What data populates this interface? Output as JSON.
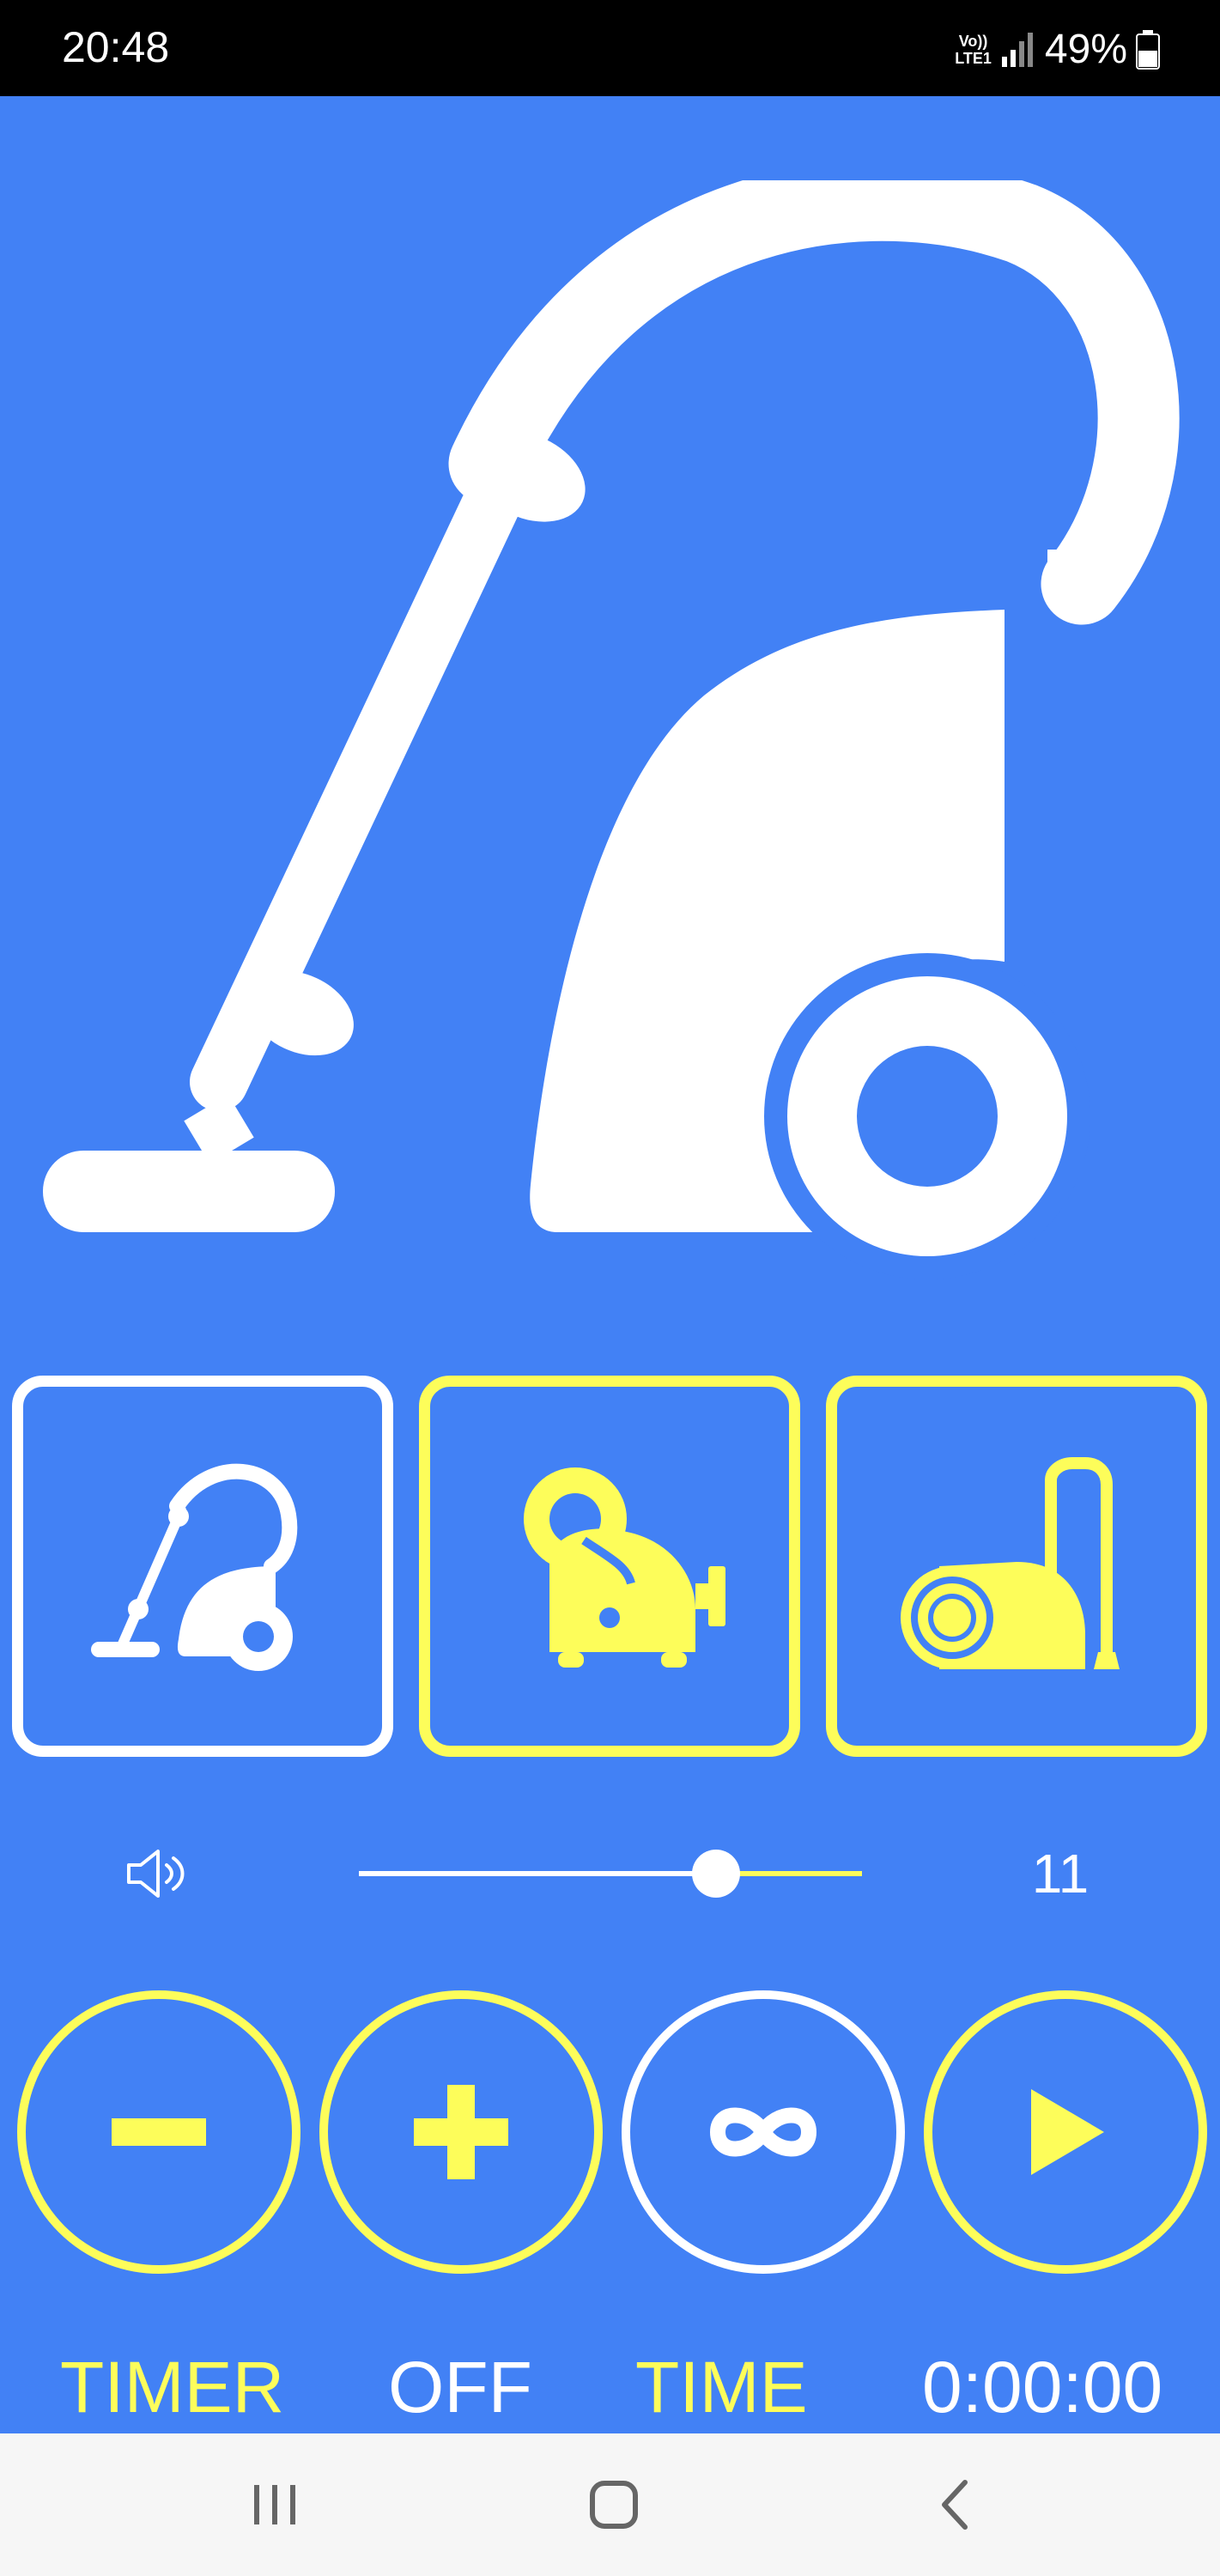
{
  "status_bar": {
    "time": "20:48",
    "network_label_top": "Vo))",
    "network_label_bottom": "LTE1",
    "battery": "49%"
  },
  "modes": [
    {
      "name": "upright-vacuum",
      "selected": true
    },
    {
      "name": "canister-vacuum",
      "selected": false
    },
    {
      "name": "cylinder-vacuum",
      "selected": false
    }
  ],
  "volume": {
    "value": "11",
    "level": 0.71
  },
  "controls": {
    "minus": "minus-icon",
    "plus": "plus-icon",
    "loop": "infinity-icon",
    "play": "play-icon"
  },
  "info": {
    "timer_label": "TIMER",
    "timer_state": "OFF",
    "time_label": "TIME",
    "time_value": "0:00:00"
  },
  "colors": {
    "background": "#4281f5",
    "accent": "#fdfd5a",
    "foreground": "#ffffff"
  }
}
